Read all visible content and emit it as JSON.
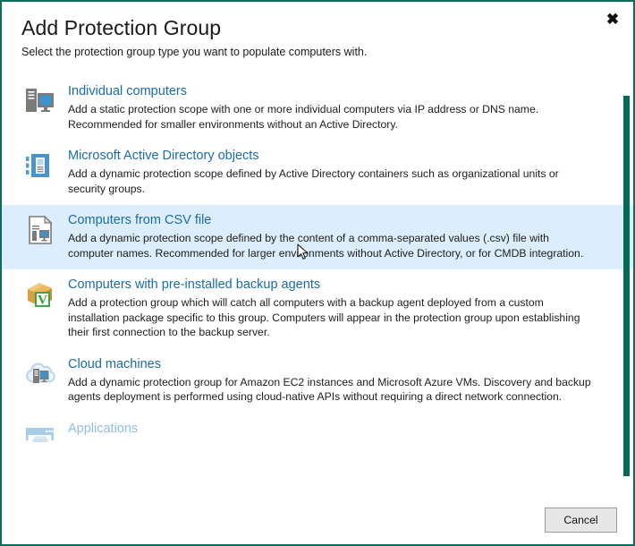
{
  "dialog": {
    "title": "Add Protection Group",
    "subtitle": "Select the protection group type you want to populate computers with.",
    "close_label": "✖",
    "accent_color": "#0d6e5c",
    "link_color": "#1b6ba8",
    "selected_row_color": "#dceefb",
    "scrollbar_color": "#016a52"
  },
  "options": [
    {
      "icon": "desktop-computer-icon",
      "title": "Individual computers",
      "description": "Add a static protection scope with one or more individual computers via IP address or DNS name. Recommended for smaller environments without an Active Directory.",
      "selected": false,
      "disabled": false
    },
    {
      "icon": "active-directory-icon",
      "title": "Microsoft Active Directory objects",
      "description": "Add a dynamic protection scope defined by Active Directory containers such as organizational units or security groups.",
      "selected": false,
      "disabled": false
    },
    {
      "icon": "csv-file-icon",
      "title": "Computers from CSV file",
      "description": "Add a dynamic protection scope defined by the content of a comma-separated values (.csv) file with computer names. Recommended for larger environments without Active Directory, or for CMDB integration.",
      "selected": true,
      "disabled": false
    },
    {
      "icon": "backup-agent-package-icon",
      "title": "Computers with pre-installed backup agents",
      "description": "Add a protection group which will catch all computers with a backup agent deployed from a custom installation package specific to this group. Computers will appear in the protection group upon establishing their first connection to the backup server.",
      "selected": false,
      "disabled": false
    },
    {
      "icon": "cloud-machines-icon",
      "title": "Cloud machines",
      "description": "Add a dynamic protection group for Amazon EC2 instances and Microsoft Azure VMs. Discovery and backup agents deployment is performed using cloud-native APIs without requiring a direct network connection.",
      "selected": false,
      "disabled": false
    },
    {
      "icon": "applications-server-icon",
      "title": "Applications",
      "description": "",
      "selected": false,
      "disabled": true
    }
  ],
  "footer": {
    "cancel_label": "Cancel"
  }
}
